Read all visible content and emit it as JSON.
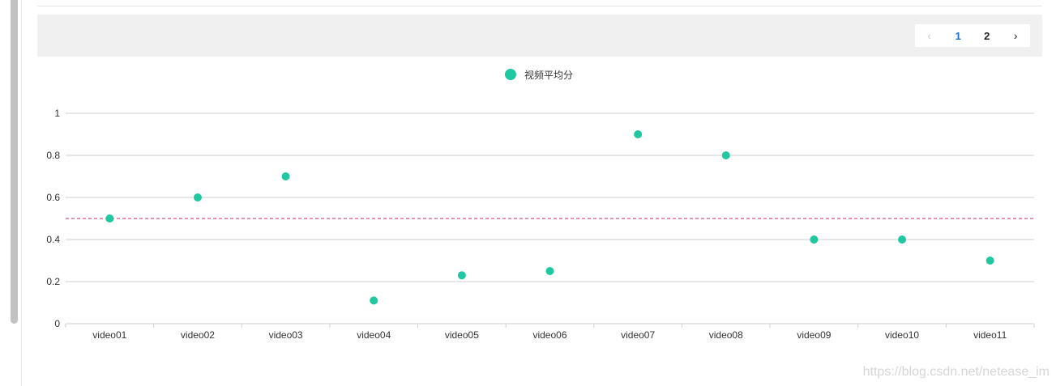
{
  "pagination": {
    "prev_icon": "chevron-left-icon",
    "pages": [
      "1",
      "2"
    ],
    "active_page": "1",
    "next_icon": "chevron-right-icon"
  },
  "chart_data": {
    "type": "scatter",
    "categories": [
      "video01",
      "video02",
      "video03",
      "video04",
      "video05",
      "video06",
      "video07",
      "video08",
      "video09",
      "video10",
      "video11"
    ],
    "series": [
      {
        "name": "视频平均分",
        "values": [
          0.5,
          0.6,
          0.7,
          0.11,
          0.23,
          0.25,
          0.9,
          0.8,
          0.4,
          0.4,
          0.3
        ],
        "color": "#1fc8a0"
      }
    ],
    "y_ticks": [
      "0",
      "0.2",
      "0.4",
      "0.6",
      "0.8",
      "1"
    ],
    "ylim": [
      0,
      1
    ],
    "reference_line": {
      "value": 0.5,
      "color": "#d0567f",
      "style": "dashed"
    },
    "grid": true,
    "legend_position": "top-center",
    "title": "",
    "xlabel": "",
    "ylabel": ""
  },
  "watermark": "https://blog.csdn.net/netease_im"
}
